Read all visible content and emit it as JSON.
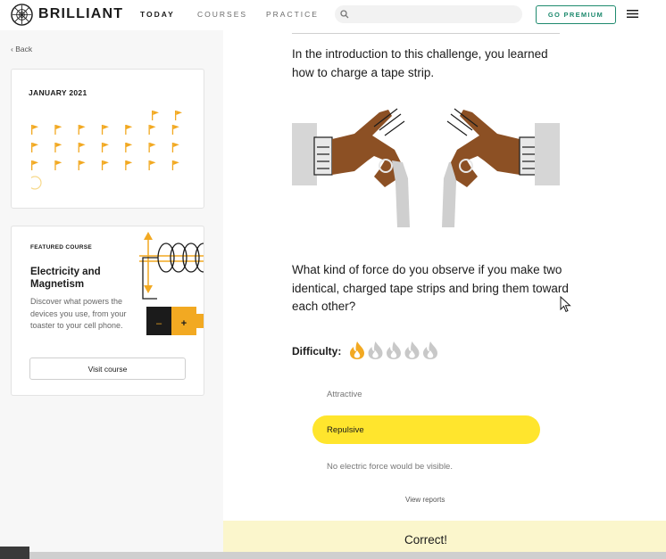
{
  "header": {
    "brand": "BRILLIANT",
    "nav": [
      {
        "label": "TODAY",
        "active": true
      },
      {
        "label": "COURSES",
        "active": false
      },
      {
        "label": "PRACTICE",
        "active": false
      }
    ],
    "search_placeholder": "",
    "premium_label": "GO PREMIUM"
  },
  "sidebar": {
    "back_label": "Back",
    "calendar": {
      "month": "JANUARY 2021",
      "flag_color": "#f2a922",
      "today_marker_color": "#f7d98c"
    },
    "featured": {
      "eyebrow": "FEATURED COURSE",
      "title": "Electricity and Magnetism",
      "description": "Discover what powers the devices you use, from your toaster to your cell phone.",
      "button": "Visit course",
      "battery_minus": "–",
      "battery_plus": "+"
    }
  },
  "main": {
    "intro": "In the introduction to this challenge, you learned how to charge a tape strip.",
    "question": "What kind of force do you observe if you make two identical, charged tape strips and bring them toward each other?",
    "difficulty_label": "Difficulty:",
    "difficulty_level": 1,
    "difficulty_max": 5,
    "options": [
      {
        "label": "Attractive",
        "selected": false
      },
      {
        "label": "Repulsive",
        "selected": true
      },
      {
        "label": "No electric force would be visible.",
        "selected": false
      }
    ],
    "view_reports": "View reports",
    "feedback": "Correct!"
  },
  "colors": {
    "accent_green": "#1e8a6e",
    "selected_option": "#ffe52d",
    "correct_banner": "#fbf6cc",
    "flame_active": "#f2a922",
    "flame_inactive": "#c8c8c8",
    "hand_skin": "#8c5024",
    "sleeve": "#d6d6d6"
  }
}
